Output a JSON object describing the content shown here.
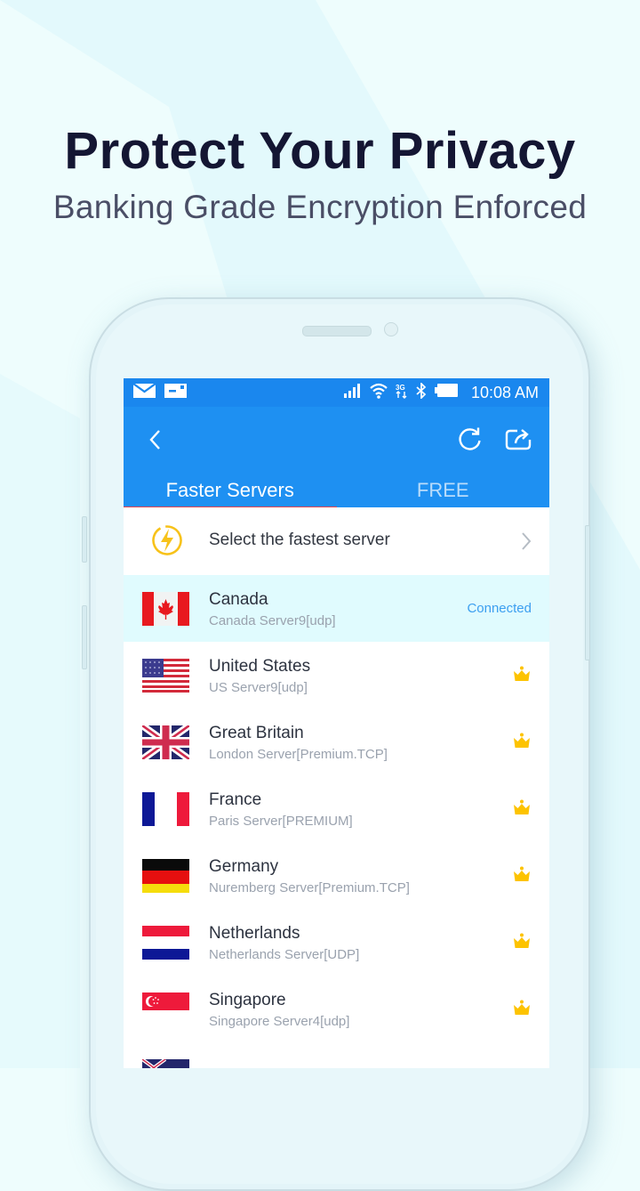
{
  "promo": {
    "headline": "Protect Your Privacy",
    "subheadline": "Banking Grade Encryption Enforced"
  },
  "statusbar": {
    "left_icons": [
      "mail-icon",
      "sim-card-icon"
    ],
    "right_icons": [
      "signal-icon",
      "wifi-icon",
      "3g-data-icon",
      "bluetooth-icon",
      "battery-icon"
    ],
    "time": "10:08 AM"
  },
  "appbar": {
    "back_icon": "chevron-left-icon",
    "actions": [
      "refresh-icon",
      "share-icon"
    ]
  },
  "tabs": [
    {
      "label": "Faster Servers",
      "active": true
    },
    {
      "label": "FREE",
      "active": false
    }
  ],
  "fastest": {
    "icon": "lightning-bolt-icon",
    "label": "Select the fastest server"
  },
  "colors": {
    "primary": "#1e90f2",
    "tab_indicator": "#f0434e",
    "connected_text": "#3c9ff0",
    "connected_bg": "#e0fbfe",
    "crown": "#fdc300",
    "bolt": "#f7c21a"
  },
  "servers": [
    {
      "country": "Canada",
      "server": "Canada Server9[udp]",
      "flag": "canada",
      "status": "Connected",
      "premium": false
    },
    {
      "country": "United States",
      "server": "US Server9[udp]",
      "flag": "usa",
      "status": "",
      "premium": true
    },
    {
      "country": "Great Britain",
      "server": "London Server[Premium.TCP]",
      "flag": "uk",
      "status": "",
      "premium": true
    },
    {
      "country": "France",
      "server": "Paris Server[PREMIUM]",
      "flag": "france",
      "status": "",
      "premium": true
    },
    {
      "country": "Germany",
      "server": "Nuremberg Server[Premium.TCP]",
      "flag": "germany",
      "status": "",
      "premium": true
    },
    {
      "country": "Netherlands",
      "server": "Netherlands Server[UDP]",
      "flag": "netherlands",
      "status": "",
      "premium": true
    },
    {
      "country": "Singapore",
      "server": "Singapore Server4[udp]",
      "flag": "singapore",
      "status": "",
      "premium": true
    }
  ]
}
